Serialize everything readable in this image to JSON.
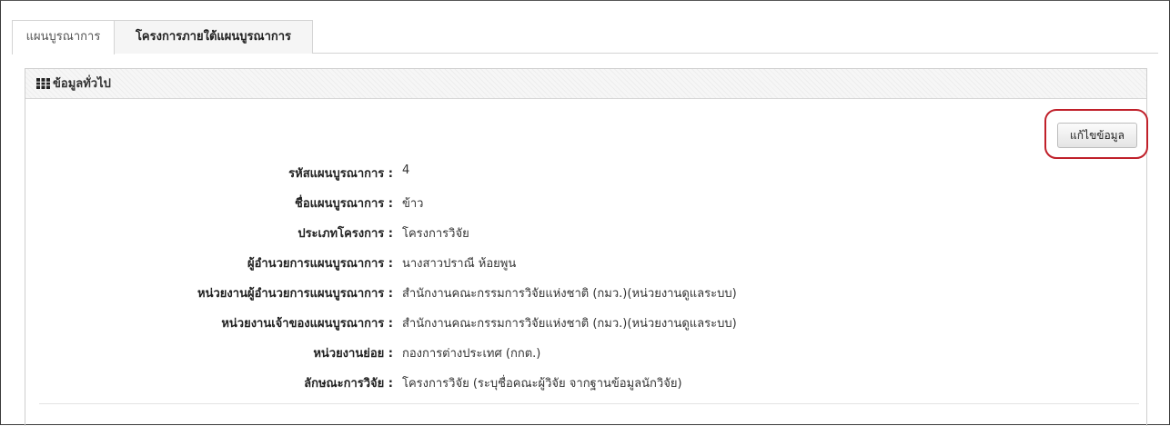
{
  "tabs": [
    {
      "label": "แผนบูรณาการ"
    },
    {
      "label": "โครงการภายใต้แผนบูรณาการ"
    }
  ],
  "panel": {
    "title": "ข้อมูลทั่วไป",
    "icon": "table-icon"
  },
  "edit_button": {
    "label": "แก้ไขข้อมูล",
    "highlight_color": "#c0202a"
  },
  "details": [
    {
      "label": "รหัสแผนบูรณาการ :",
      "value": "4"
    },
    {
      "label": "ชื่อแผนบูรณาการ :",
      "value": "ข้าว"
    },
    {
      "label": "ประเภทโครงการ :",
      "value": "โครงการวิจัย"
    },
    {
      "label": "ผู้อำนวยการแผนบูรณาการ :",
      "value": "นางสาวปราณี ห้อยพูน"
    },
    {
      "label": "หน่วยงานผู้อำนวยการแผนบูรณาการ :",
      "value": "สำนักงานคณะกรรมการวิจัยแห่งชาติ (กมว.)(หน่วยงานดูแลระบบ)"
    },
    {
      "label": "หน่วยงานเจ้าของแผนบูรณาการ :",
      "value": "สำนักงานคณะกรรมการวิจัยแห่งชาติ (กมว.)(หน่วยงานดูแลระบบ)"
    },
    {
      "label": "หน่วยงานย่อย :",
      "value": "กองการต่างประเทศ (กกต.)"
    },
    {
      "label": "ลักษณะการวิจัย :",
      "value": "โครงการวิจัย (ระบุชื่อคณะผู้วิจัย จากฐานข้อมูลนักวิจัย)"
    }
  ]
}
